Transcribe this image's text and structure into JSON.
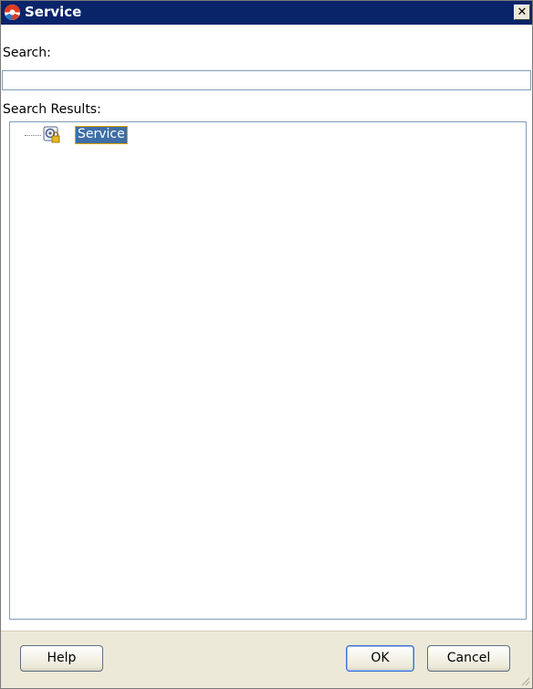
{
  "window": {
    "title": "Service",
    "close_glyph": "✕"
  },
  "search": {
    "label": "Search:",
    "value": "",
    "placeholder": ""
  },
  "results": {
    "label": "Search Results:",
    "items": [
      {
        "label": "Service",
        "icon": "service-lock-icon",
        "selected": true
      }
    ]
  },
  "buttons": {
    "help": "Help",
    "ok": "OK",
    "cancel": "Cancel"
  },
  "colors": {
    "titlebar": "#0a246a",
    "selection": "#3d6ea5",
    "selection_border": "#e0a000"
  }
}
